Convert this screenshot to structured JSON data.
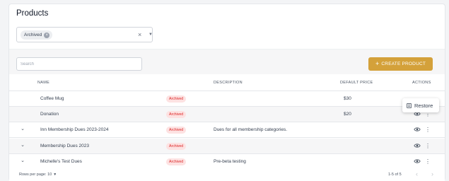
{
  "page": {
    "title": "Products"
  },
  "filter": {
    "chip_label": "Archived",
    "chip_remove_icon": "close-circle-icon",
    "clear_icon": "close-icon",
    "caret_icon": "caret-down-icon",
    "clear_glyph": "×",
    "caret_glyph": "▼"
  },
  "toolbar": {
    "search_placeholder": "Search",
    "create_label": "CREATE PRODUCT",
    "create_icon": "plus-icon",
    "accent_color": "#d4a13a"
  },
  "table": {
    "headers": {
      "name": "NAME",
      "description": "DESCRIPTION",
      "price": "DEFAULT PRICE",
      "actions": "ACTIONS"
    },
    "rows": [
      {
        "expandable": false,
        "name": "Coffee Mug",
        "status": "Archived",
        "description": "",
        "price": "$30"
      },
      {
        "expandable": false,
        "name": "Donation",
        "status": "Archived",
        "description": "",
        "price": "$20"
      },
      {
        "expandable": true,
        "name": "Inn Membership Dues 2023-2024",
        "status": "Archived",
        "description": "Dues for all membership categories.",
        "price": ""
      },
      {
        "expandable": true,
        "name": "Membership Dues 2023",
        "status": "Archived",
        "description": "",
        "price": ""
      },
      {
        "expandable": true,
        "name": "Michelle's Test Dues",
        "status": "Archived",
        "description": "Pre-beta testing",
        "price": ""
      }
    ],
    "row_icons": {
      "expand": "chevron-down-icon",
      "view": "eye-icon",
      "more": "more-vertical-icon"
    },
    "badge_color": "#dc2626",
    "badge_bg": "#fde2e2"
  },
  "context_menu": {
    "restore_label": "Restore",
    "restore_icon": "restore-icon"
  },
  "footer": {
    "rows_per_page_label": "Rows per page:",
    "rows_per_page_value": "10",
    "range": "1-5 of 5",
    "prev_glyph": "‹",
    "next_glyph": "›"
  }
}
